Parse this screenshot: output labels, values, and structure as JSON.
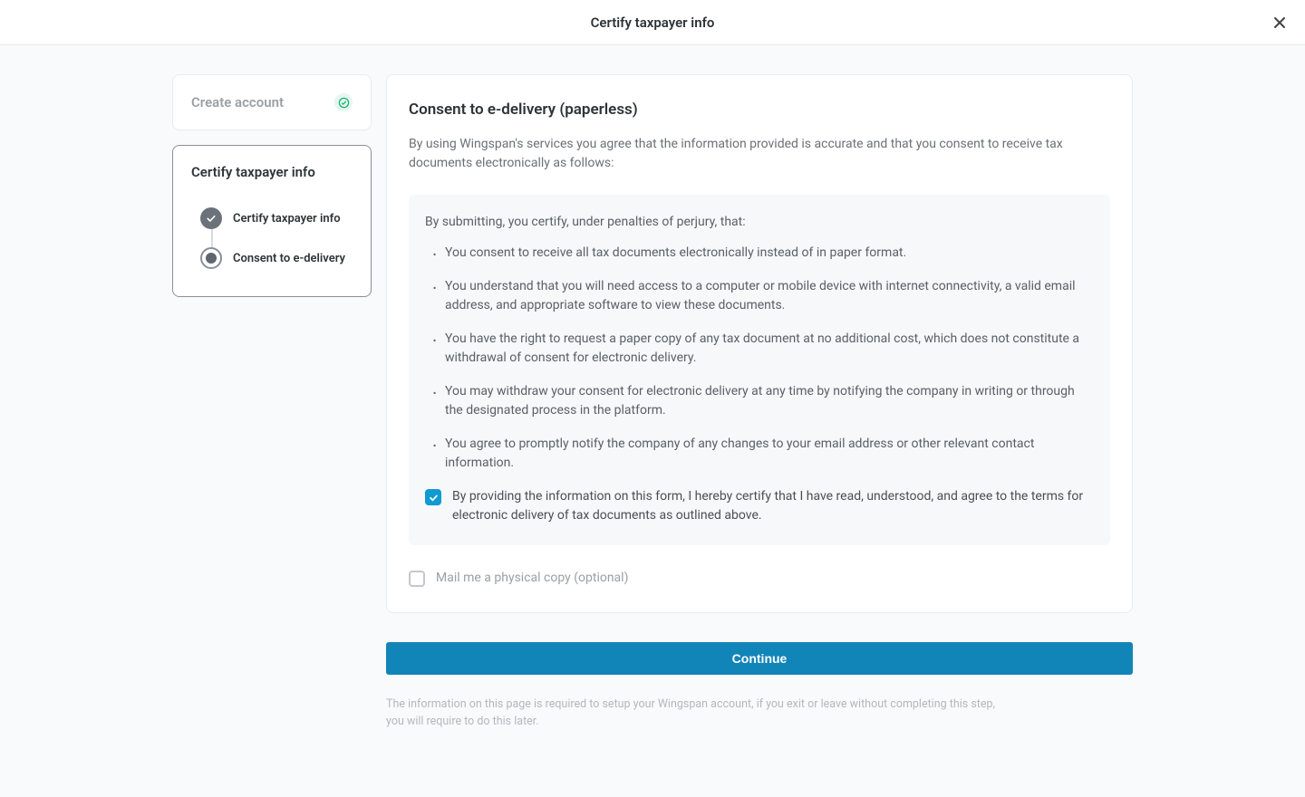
{
  "header": {
    "title": "Certify taxpayer info"
  },
  "sidebar": {
    "cards": [
      {
        "title": "Create account",
        "state": "complete"
      },
      {
        "title": "Certify taxpayer info",
        "state": "active",
        "steps": [
          {
            "label": "Certify taxpayer info",
            "state": "done"
          },
          {
            "label": "Consent to e-delivery",
            "state": "current"
          }
        ]
      }
    ]
  },
  "main": {
    "heading": "Consent to e-delivery (paperless)",
    "intro": "By using Wingspan's services you agree that the information provided is accurate and that you consent to receive tax documents electronically as follows:",
    "consent": {
      "lead": "By submitting, you certify, under penalties of perjury, that:",
      "items": [
        "You consent to receive all tax documents electronically instead of in paper format.",
        "You understand that you will need access to a computer or mobile device with internet connectivity, a valid email address, and appropriate software to view these documents.",
        "You have the right to request a paper copy of any tax document at no additional cost, which does not constitute a withdrawal of consent for electronic delivery.",
        "You may withdraw your consent for electronic delivery at any time by notifying the company in writing or through the designated process in the platform.",
        "You agree to promptly notify the company of any changes to your email address or other relevant contact information."
      ],
      "confirm_label": "By providing the information on this form, I hereby certify that I have read, understood, and agree to the terms for electronic delivery of tax documents as outlined above."
    },
    "mail_label": "Mail me a physical copy (optional)",
    "continue_label": "Continue",
    "footnote": "The information on this page is required to setup your Wingspan account, if you exit or leave without completing this step, you will require to do this later."
  }
}
